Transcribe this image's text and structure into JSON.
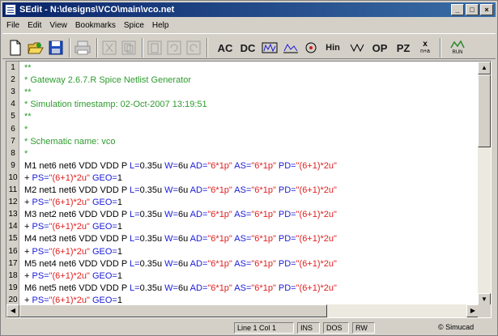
{
  "window": {
    "title": "SEdit - N:\\designs\\VCO\\main\\vco.net",
    "buttons": {
      "minimize": "_",
      "maximize": "□",
      "close": "×"
    }
  },
  "menu": [
    "File",
    "Edit",
    "View",
    "Bookmarks",
    "Spice",
    "Help"
  ],
  "toolbar": {
    "icons": [
      "new-file-icon",
      "open-folder-icon",
      "save-icon",
      "print-icon",
      "cut-icon",
      "copy-icon",
      "paste-icon",
      "undo-icon",
      "redo-icon"
    ],
    "analysis_labels": {
      "ac": "AC",
      "dc": "DC",
      "transient_label": "Hin",
      "op": "OP",
      "pz": "PZ",
      "noise": "x",
      "noise_sub": "n+a",
      "run": "RUN"
    }
  },
  "editor": {
    "line_numbers": [
      "1",
      "2",
      "3",
      "4",
      "5",
      "6",
      "7",
      "8",
      "9",
      "10",
      "11",
      "12",
      "13",
      "14",
      "15",
      "16",
      "17",
      "18",
      "19",
      "20"
    ],
    "lines": [
      [
        {
          "t": "**",
          "c": "comment"
        }
      ],
      [
        {
          "t": "* Gateway 2.6.7.R Spice Netlist Generator",
          "c": "comment"
        }
      ],
      [
        {
          "t": "**",
          "c": "comment"
        }
      ],
      [
        {
          "t": "* Simulation timestamp: 02-Oct-2007 13:19:51",
          "c": "comment"
        }
      ],
      [
        {
          "t": "**",
          "c": "comment"
        }
      ],
      [
        {
          "t": "*",
          "c": "comment"
        }
      ],
      [
        {
          "t": "* Schematic name: vco",
          "c": "comment"
        }
      ],
      [
        {
          "t": "*",
          "c": "comment"
        }
      ],
      [
        {
          "t": "M1 net6 net6 VDD VDD P ",
          "c": "text"
        },
        {
          "t": "L=",
          "c": "kw"
        },
        {
          "t": "0.35u ",
          "c": "text"
        },
        {
          "t": "W=",
          "c": "kw"
        },
        {
          "t": "6u ",
          "c": "text"
        },
        {
          "t": "AD=",
          "c": "kw"
        },
        {
          "t": "\"6*1p\" ",
          "c": "str"
        },
        {
          "t": "AS=",
          "c": "kw"
        },
        {
          "t": "\"6*1p\" ",
          "c": "str"
        },
        {
          "t": "PD=",
          "c": "kw"
        },
        {
          "t": "\"(6+1)*2u\"",
          "c": "str"
        }
      ],
      [
        {
          "t": "+ ",
          "c": "text"
        },
        {
          "t": "PS=",
          "c": "kw"
        },
        {
          "t": "\"(6+1)*2u\" ",
          "c": "str"
        },
        {
          "t": "GEO=",
          "c": "kw"
        },
        {
          "t": "1",
          "c": "text"
        }
      ],
      [
        {
          "t": "M2 net1 net6 VDD VDD P ",
          "c": "text"
        },
        {
          "t": "L=",
          "c": "kw"
        },
        {
          "t": "0.35u ",
          "c": "text"
        },
        {
          "t": "W=",
          "c": "kw"
        },
        {
          "t": "6u ",
          "c": "text"
        },
        {
          "t": "AD=",
          "c": "kw"
        },
        {
          "t": "\"6*1p\" ",
          "c": "str"
        },
        {
          "t": "AS=",
          "c": "kw"
        },
        {
          "t": "\"6*1p\" ",
          "c": "str"
        },
        {
          "t": "PD=",
          "c": "kw"
        },
        {
          "t": "\"(6+1)*2u\"",
          "c": "str"
        }
      ],
      [
        {
          "t": "+ ",
          "c": "text"
        },
        {
          "t": "PS=",
          "c": "kw"
        },
        {
          "t": "\"(6+1)*2u\" ",
          "c": "str"
        },
        {
          "t": "GEO=",
          "c": "kw"
        },
        {
          "t": "1",
          "c": "text"
        }
      ],
      [
        {
          "t": "M3 net2 net6 VDD VDD P ",
          "c": "text"
        },
        {
          "t": "L=",
          "c": "kw"
        },
        {
          "t": "0.35u ",
          "c": "text"
        },
        {
          "t": "W=",
          "c": "kw"
        },
        {
          "t": "6u ",
          "c": "text"
        },
        {
          "t": "AD=",
          "c": "kw"
        },
        {
          "t": "\"6*1p\" ",
          "c": "str"
        },
        {
          "t": "AS=",
          "c": "kw"
        },
        {
          "t": "\"6*1p\" ",
          "c": "str"
        },
        {
          "t": "PD=",
          "c": "kw"
        },
        {
          "t": "\"(6+1)*2u\"",
          "c": "str"
        }
      ],
      [
        {
          "t": "+ ",
          "c": "text"
        },
        {
          "t": "PS=",
          "c": "kw"
        },
        {
          "t": "\"(6+1)*2u\" ",
          "c": "str"
        },
        {
          "t": "GEO=",
          "c": "kw"
        },
        {
          "t": "1",
          "c": "text"
        }
      ],
      [
        {
          "t": "M4 net3 net6 VDD VDD P ",
          "c": "text"
        },
        {
          "t": "L=",
          "c": "kw"
        },
        {
          "t": "0.35u ",
          "c": "text"
        },
        {
          "t": "W=",
          "c": "kw"
        },
        {
          "t": "6u ",
          "c": "text"
        },
        {
          "t": "AD=",
          "c": "kw"
        },
        {
          "t": "\"6*1p\" ",
          "c": "str"
        },
        {
          "t": "AS=",
          "c": "kw"
        },
        {
          "t": "\"6*1p\" ",
          "c": "str"
        },
        {
          "t": "PD=",
          "c": "kw"
        },
        {
          "t": "\"(6+1)*2u\"",
          "c": "str"
        }
      ],
      [
        {
          "t": "+ ",
          "c": "text"
        },
        {
          "t": "PS=",
          "c": "kw"
        },
        {
          "t": "\"(6+1)*2u\" ",
          "c": "str"
        },
        {
          "t": "GEO=",
          "c": "kw"
        },
        {
          "t": "1",
          "c": "text"
        }
      ],
      [
        {
          "t": "M5 net4 net6 VDD VDD P ",
          "c": "text"
        },
        {
          "t": "L=",
          "c": "kw"
        },
        {
          "t": "0.35u ",
          "c": "text"
        },
        {
          "t": "W=",
          "c": "kw"
        },
        {
          "t": "6u ",
          "c": "text"
        },
        {
          "t": "AD=",
          "c": "kw"
        },
        {
          "t": "\"6*1p\" ",
          "c": "str"
        },
        {
          "t": "AS=",
          "c": "kw"
        },
        {
          "t": "\"6*1p\" ",
          "c": "str"
        },
        {
          "t": "PD=",
          "c": "kw"
        },
        {
          "t": "\"(6+1)*2u\"",
          "c": "str"
        }
      ],
      [
        {
          "t": "+ ",
          "c": "text"
        },
        {
          "t": "PS=",
          "c": "kw"
        },
        {
          "t": "\"(6+1)*2u\" ",
          "c": "str"
        },
        {
          "t": "GEO=",
          "c": "kw"
        },
        {
          "t": "1",
          "c": "text"
        }
      ],
      [
        {
          "t": "M6 net5 net6 VDD VDD P ",
          "c": "text"
        },
        {
          "t": "L=",
          "c": "kw"
        },
        {
          "t": "0.35u ",
          "c": "text"
        },
        {
          "t": "W=",
          "c": "kw"
        },
        {
          "t": "6u ",
          "c": "text"
        },
        {
          "t": "AD=",
          "c": "kw"
        },
        {
          "t": "\"6*1p\" ",
          "c": "str"
        },
        {
          "t": "AS=",
          "c": "kw"
        },
        {
          "t": "\"6*1p\" ",
          "c": "str"
        },
        {
          "t": "PD=",
          "c": "kw"
        },
        {
          "t": "\"(6+1)*2u\"",
          "c": "str"
        }
      ],
      [
        {
          "t": "+ ",
          "c": "text"
        },
        {
          "t": "PS=",
          "c": "kw"
        },
        {
          "t": "\"(6+1)*2u\" ",
          "c": "str"
        },
        {
          "t": "GEO=",
          "c": "kw"
        },
        {
          "t": "1",
          "c": "text"
        }
      ]
    ]
  },
  "status": {
    "position": "Line 1 Col 1",
    "insert_mode": "INS",
    "line_endings": "DOS",
    "access": "RW",
    "company": "© Simucad"
  },
  "colors": {
    "comment": "#2e9b2e",
    "keyword": "#1a1ad8",
    "string": "#e02020",
    "text": "#000000",
    "titlebar": "#0a246a"
  }
}
